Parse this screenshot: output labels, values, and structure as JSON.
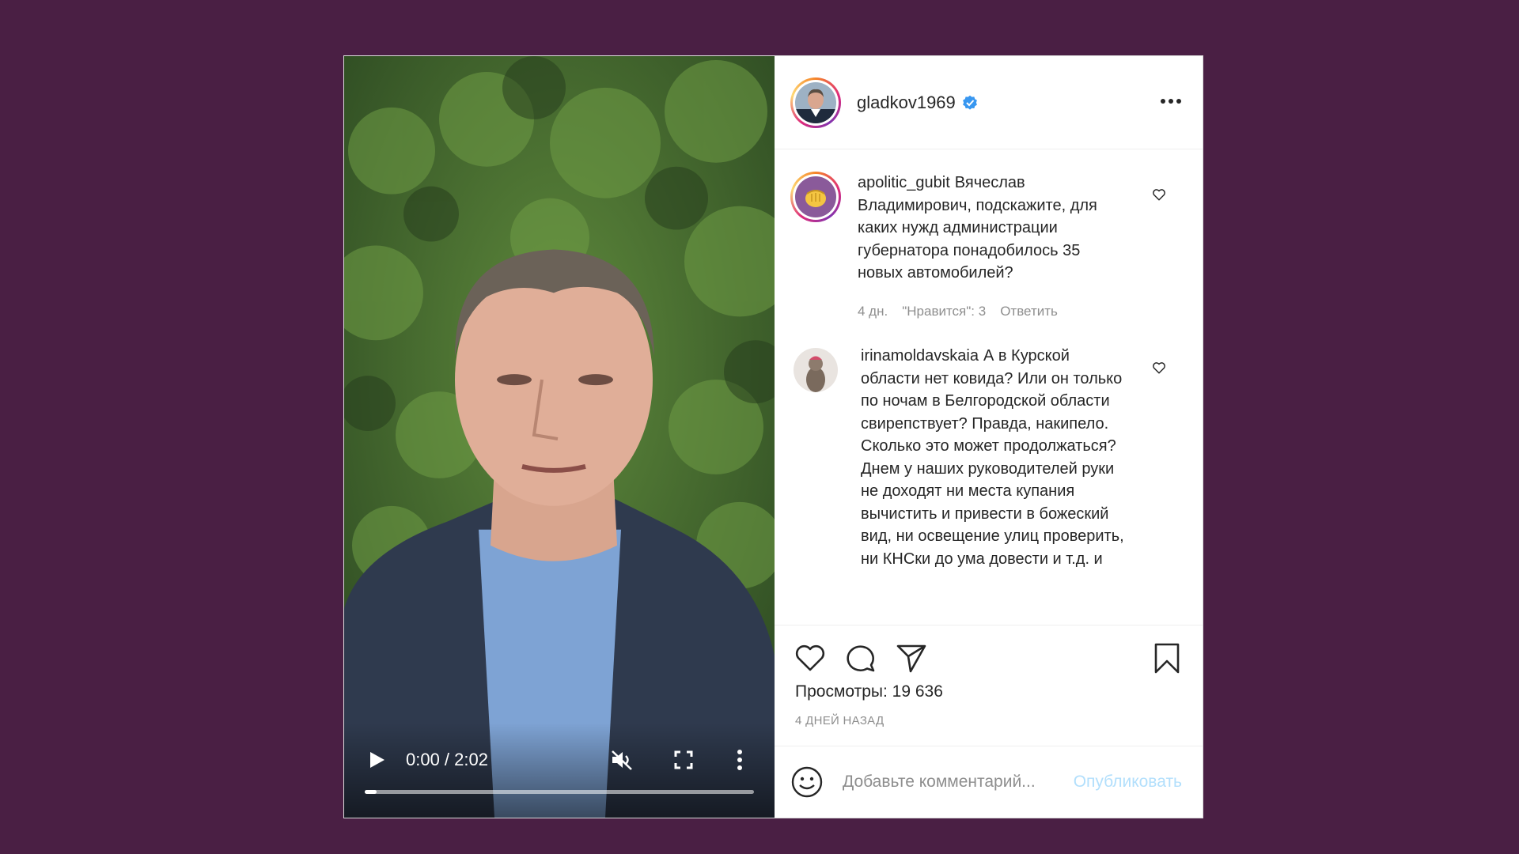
{
  "post": {
    "author": "gladkov1969",
    "video": {
      "time": "0:00 / 2:02",
      "progress": 0.0
    },
    "comments": [
      {
        "user": "apolitic_gubit",
        "text": "Вячеслав Владимирович, подскажите, для каких нужд администрации губернатора понадобилось 35 новых автомобилей?",
        "age": "4 дн.",
        "likes": "\"Нравится\": 3",
        "reply_label": "Ответить"
      },
      {
        "user": "irinamoldavskaia",
        "text": "А в Курской области нет ковида? Или он только по ночам в Белгородской области свирепствует? Правда, накипело. Сколько это может продолжаться? Днем у наших руководителей руки не доходят ни места купания вычистить и привести в божеский вид, ни освещение улиц проверить, ни КНСки до ума довести и т.д. и"
      }
    ],
    "views": "Просмотры: 19 636",
    "posted_ago": "4 ДНЕЙ НАЗАД",
    "comment_input": {
      "placeholder": "Добавьте комментарий...",
      "publish_label": "Опубликовать"
    }
  },
  "colors": {
    "page_background": "#4a1f44",
    "verified_badge": "#3897f0",
    "publish_disabled": "#b2dffc",
    "secondary_text": "#8e8e8e"
  },
  "icons": {
    "verified": "verified-badge-icon",
    "more": "more-options-icon",
    "like": "heart-icon",
    "comment": "comment-bubble-icon",
    "share": "paper-plane-icon",
    "save": "bookmark-icon",
    "emoji": "smiley-icon",
    "play": "play-icon",
    "mute": "muted-speaker-icon",
    "fullscreen": "fullscreen-icon",
    "video_menu": "vertical-dots-icon"
  }
}
